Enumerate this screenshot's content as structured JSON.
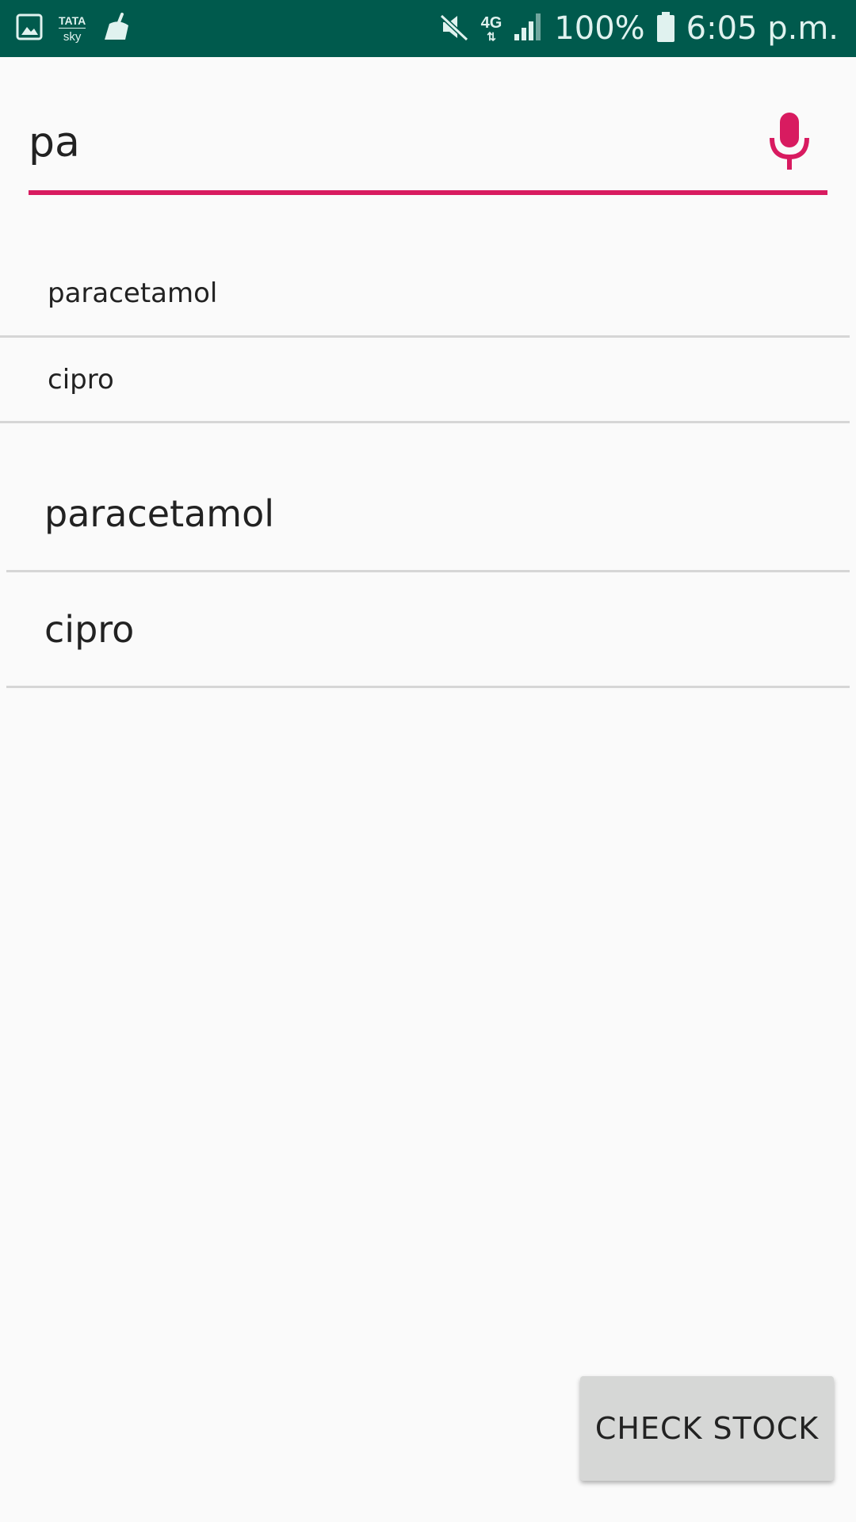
{
  "status_bar": {
    "left_icons": [
      "image-icon",
      "tata-sky-icon",
      "cleaner-broom-icon"
    ],
    "tata_line1": "TATA",
    "tata_line2": "sky",
    "right_icons": [
      "mute-icon",
      "network-4g-icon",
      "signal-icon",
      "battery-icon"
    ],
    "network_label": "4G",
    "battery": "100%",
    "time": "6:05 p.m."
  },
  "search": {
    "value": "pa",
    "placeholder": "",
    "mic_icon": "mic-icon",
    "accent_color": "#d81b60"
  },
  "suggestions": [
    {
      "label": "paracetamol"
    },
    {
      "label": "cipro"
    }
  ],
  "results": [
    {
      "label": "paracetamol"
    },
    {
      "label": "cipro"
    }
  ],
  "actions": {
    "check_stock_label": "CHECK STOCK"
  },
  "colors": {
    "status_bar": "#005a4d",
    "background": "#fafafa",
    "button_bg": "#d6d7d6"
  }
}
